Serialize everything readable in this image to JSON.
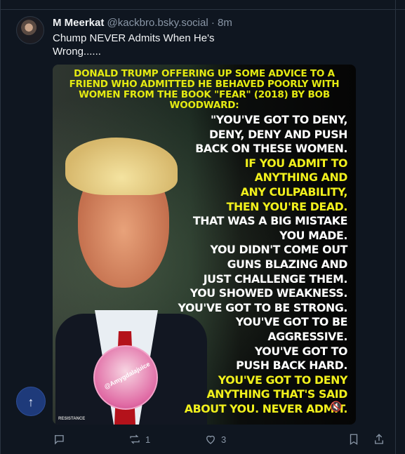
{
  "post": {
    "author_name": "M Meerkat",
    "author_handle": "@kackbro.bsky.social",
    "separator": "·",
    "time": "8m",
    "text": "Chump NEVER Admits When He's Wrong......",
    "media": {
      "caption": "DONALD TRUMP OFFERING UP SOME ADVICE TO A FRIEND WHO ADMITTED HE BEHAVED POORLY WITH WOMEN FROM THE BOOK \"FEAR\" (2018) BY BOB WOODWARD:",
      "quote_lines": [
        {
          "text": "\"YOU'VE GOT TO DENY,",
          "color": "white"
        },
        {
          "text": "DENY, DENY AND PUSH",
          "color": "white"
        },
        {
          "text": "BACK ON THESE WOMEN.",
          "color": "white"
        },
        {
          "text": "IF YOU ADMIT TO",
          "color": "yellow"
        },
        {
          "text": "ANYTHING AND",
          "color": "yellow"
        },
        {
          "text": "ANY CULPABILITY,",
          "color": "yellow"
        },
        {
          "text": "THEN YOU'RE DEAD.",
          "color": "yellow"
        },
        {
          "text": "THAT WAS A BIG MISTAKE",
          "color": "white"
        },
        {
          "text": "YOU MADE.",
          "color": "white"
        },
        {
          "text": "YOU DIDN'T COME OUT",
          "color": "white"
        },
        {
          "text": "GUNS BLAZING AND",
          "color": "white"
        },
        {
          "text": "JUST CHALLENGE THEM.",
          "color": "white"
        },
        {
          "text": "YOU SHOWED WEAKNESS.",
          "color": "white"
        },
        {
          "text": "YOU'VE GOT TO BE STRONG.",
          "color": "white"
        },
        {
          "text": "YOU'VE GOT TO BE",
          "color": "white"
        },
        {
          "text": "AGGRESSIVE.",
          "color": "white"
        },
        {
          "text": "YOU'VE GOT TO",
          "color": "white"
        },
        {
          "text": "PUSH BACK HARD.",
          "color": "white"
        },
        {
          "text": "YOU'VE GOT TO DENY",
          "color": "yellow"
        },
        {
          "text": "ANYTHING THAT'S SAID",
          "color": "yellow"
        },
        {
          "text": "ABOUT YOU. NEVER ADMIT.",
          "color": "yellow"
        }
      ],
      "badge_text": "@Amygdalajuice",
      "watermark": "RESISTANCE",
      "mute_icon": "mute-icon"
    },
    "actions": {
      "reply_count": "",
      "repost_count": "1",
      "like_count": "3"
    }
  },
  "colors": {
    "background": "#0f1620",
    "accent_yellow": "#f1f01c",
    "muted_text": "#8996a6",
    "scroll_button": "#1e3a7a"
  }
}
